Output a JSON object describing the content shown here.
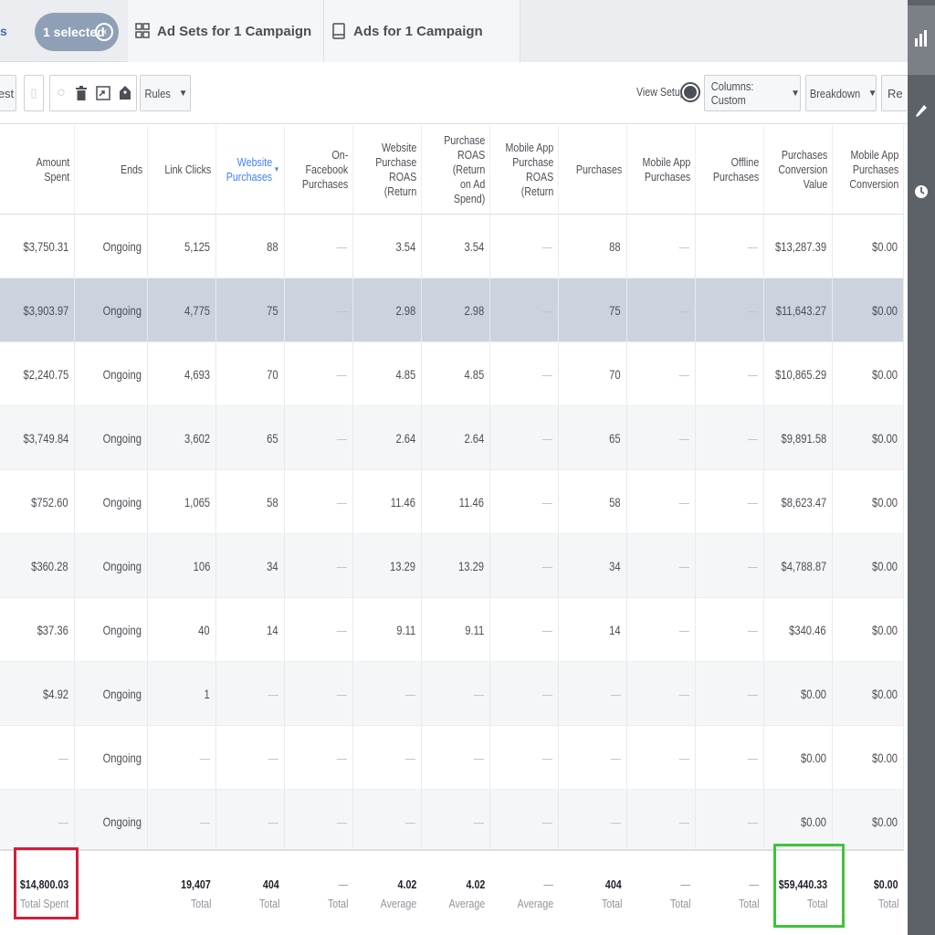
{
  "tabs": {
    "partial_label": "s",
    "selected_pill": "1 selected",
    "adsets_label": "Ad Sets for 1 Campaign",
    "ads_label": "Ads for 1 Campaign"
  },
  "toolbar": {
    "partial_left_label": "est",
    "rules_label": "Rules",
    "view_setup_label": "View Setup",
    "columns_label": "Columns: Custom",
    "breakdown_label": "Breakdown",
    "partial_right_label": "Re"
  },
  "columns": [
    {
      "key": "amount_spent",
      "label": "Amount Spent"
    },
    {
      "key": "ends",
      "label": "Ends"
    },
    {
      "key": "link_clicks",
      "label": "Link Clicks"
    },
    {
      "key": "website_purchases",
      "label": "Website\nPurchases",
      "sorted": true
    },
    {
      "key": "onfb_purchases",
      "label": "On-Facebook\nPurchases"
    },
    {
      "key": "website_roas",
      "label": "Website\nPurchase\nROAS (Return"
    },
    {
      "key": "purchase_roas",
      "label": "Purchase\nROAS (Return\non Ad Spend)"
    },
    {
      "key": "mobile_roas",
      "label": "Mobile App\nPurchase\nROAS (Return"
    },
    {
      "key": "purchases",
      "label": "Purchases"
    },
    {
      "key": "mobile_purchases",
      "label": "Mobile App\nPurchases"
    },
    {
      "key": "offline_purchases",
      "label": "Offline\nPurchases"
    },
    {
      "key": "conv_value",
      "label": "Purchases\nConversion\nValue"
    },
    {
      "key": "mobile_conv",
      "label": "Mobile App\nPurchases\nConversion"
    }
  ],
  "rows": [
    [
      "$3,750.31",
      "Ongoing",
      "5,125",
      "88",
      "—",
      "3.54",
      "3.54",
      "—",
      "88",
      "—",
      "—",
      "$13,287.39",
      "$0.00"
    ],
    [
      "$3,903.97",
      "Ongoing",
      "4,775",
      "75",
      "—",
      "2.98",
      "2.98",
      "—",
      "75",
      "—",
      "—",
      "$11,643.27",
      "$0.00"
    ],
    [
      "$2,240.75",
      "Ongoing",
      "4,693",
      "70",
      "—",
      "4.85",
      "4.85",
      "—",
      "70",
      "—",
      "—",
      "$10,865.29",
      "$0.00"
    ],
    [
      "$3,749.84",
      "Ongoing",
      "3,602",
      "65",
      "—",
      "2.64",
      "2.64",
      "—",
      "65",
      "—",
      "—",
      "$9,891.58",
      "$0.00"
    ],
    [
      "$752.60",
      "Ongoing",
      "1,065",
      "58",
      "—",
      "11.46",
      "11.46",
      "—",
      "58",
      "—",
      "—",
      "$8,623.47",
      "$0.00"
    ],
    [
      "$360.28",
      "Ongoing",
      "106",
      "34",
      "—",
      "13.29",
      "13.29",
      "—",
      "34",
      "—",
      "—",
      "$4,788.87",
      "$0.00"
    ],
    [
      "$37.36",
      "Ongoing",
      "40",
      "14",
      "—",
      "9.11",
      "9.11",
      "—",
      "14",
      "—",
      "—",
      "$340.46",
      "$0.00"
    ],
    [
      "$4.92",
      "Ongoing",
      "1",
      "—",
      "—",
      "—",
      "—",
      "—",
      "—",
      "—",
      "—",
      "$0.00",
      "$0.00"
    ],
    [
      "—",
      "Ongoing",
      "—",
      "—",
      "—",
      "—",
      "—",
      "—",
      "—",
      "—",
      "—",
      "$0.00",
      "$0.00"
    ],
    [
      "—",
      "Ongoing",
      "—",
      "—",
      "—",
      "—",
      "—",
      "—",
      "—",
      "—",
      "—",
      "$0.00",
      "$0.00"
    ]
  ],
  "totals": [
    {
      "value": "$14,800.03",
      "label": "Total Spent"
    },
    {
      "value": "",
      "label": ""
    },
    {
      "value": "19,407",
      "label": "Total"
    },
    {
      "value": "404",
      "label": "Total"
    },
    {
      "value": "—",
      "label": "Total"
    },
    {
      "value": "4.02",
      "label": "Average"
    },
    {
      "value": "4.02",
      "label": "Average"
    },
    {
      "value": "—",
      "label": "Average"
    },
    {
      "value": "404",
      "label": "Total"
    },
    {
      "value": "—",
      "label": "Total"
    },
    {
      "value": "—",
      "label": "Total"
    },
    {
      "value": "$59,440.33",
      "label": "Total"
    },
    {
      "value": "$0.00",
      "label": "Total"
    }
  ],
  "colors": {
    "highlight_row": "#ccd3de",
    "red_box": "#d21f3c",
    "green_box": "#3ec53a",
    "sorted_header": "#4080ff"
  }
}
